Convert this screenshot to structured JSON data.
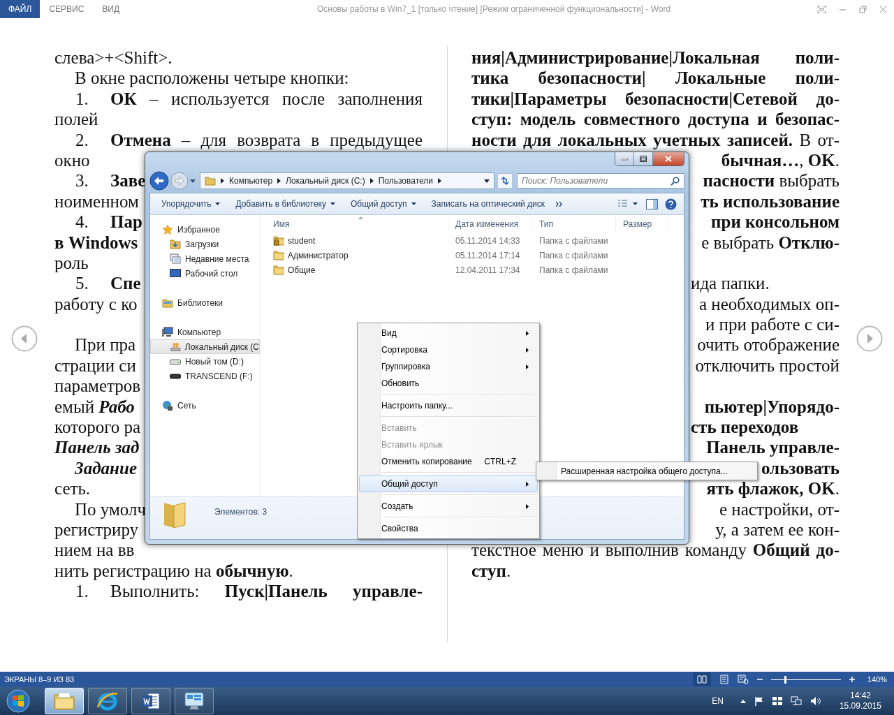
{
  "word": {
    "tabs": [
      {
        "label": "ФАЙЛ",
        "selected": true
      },
      {
        "label": "СЕРВИС",
        "selected": false
      },
      {
        "label": "ВИД",
        "selected": false
      }
    ],
    "title": "Основы работы в  Win7_1 [только чтение] [Режим ограниченной функциональности] - Word"
  },
  "document": {
    "left_column": [
      {
        "kind": "line",
        "justify": false,
        "text": "слева>+<Shift>."
      },
      {
        "kind": "first",
        "justify": false,
        "text": "В окне расположены четыре кнопки:"
      },
      {
        "kind": "item",
        "number": "1.",
        "justify": true,
        "text": "**ОК** – используется после заполнения"
      },
      {
        "kind": "line",
        "justify": false,
        "text": "полей"
      },
      {
        "kind": "item",
        "number": "2.",
        "justify": true,
        "text": "**Отмена** – для возврата в предыдущее"
      },
      {
        "kind": "line",
        "justify": false,
        "text": "окно"
      },
      {
        "kind": "item",
        "number": "3.",
        "justify": false,
        "text": "**Заве**"
      },
      {
        "kind": "line",
        "justify": false,
        "text": "ноименном"
      },
      {
        "kind": "item",
        "number": "4.",
        "justify": false,
        "text": "**Пар**"
      },
      {
        "kind": "line",
        "justify": false,
        "text": "**в Windows**"
      },
      {
        "kind": "line",
        "justify": false,
        "text": "роль"
      },
      {
        "kind": "item",
        "number": "5.",
        "justify": false,
        "text": "**Спе**"
      },
      {
        "kind": "line",
        "justify": false,
        "text": "работу с ко"
      },
      {
        "kind": "blank"
      },
      {
        "kind": "first",
        "justify": false,
        "text": "При пра"
      },
      {
        "kind": "line",
        "justify": false,
        "text": "страции си"
      },
      {
        "kind": "line",
        "justify": false,
        "text": "параметров"
      },
      {
        "kind": "line",
        "justify": false,
        "text": "емый *Рабо*"
      },
      {
        "kind": "line",
        "justify": false,
        "text": "которого ра"
      },
      {
        "kind": "line",
        "justify": false,
        "text": "*Панель зад*"
      },
      {
        "kind": "first",
        "justify": false,
        "text": "*Задание*"
      },
      {
        "kind": "line",
        "justify": false,
        "text": "сеть."
      },
      {
        "kind": "first",
        "justify": false,
        "text": "По умолч"
      },
      {
        "kind": "line",
        "justify": false,
        "text": "регистриру"
      },
      {
        "kind": "line",
        "justify": false,
        "text": "нием на вв"
      },
      {
        "kind": "line",
        "justify": false,
        "text": "нить регистрацию на **обычную**."
      },
      {
        "kind": "item",
        "number": "1.",
        "justify": true,
        "text": "Выполнить: **Пуск|Панель управле-**"
      }
    ],
    "right_column": [
      {
        "kind": "line",
        "justify": true,
        "text": "**ния|Администрирование|Локальная поли-**"
      },
      {
        "kind": "line",
        "justify": true,
        "text": "**тика безопасности| Локальные поли-**"
      },
      {
        "kind": "line",
        "justify": true,
        "text": "**тики|Параметры безопасности|Сетевой до-**"
      },
      {
        "kind": "line",
        "justify": true,
        "text": "**ступ: модель совместного доступа и безопас-**"
      },
      {
        "kind": "line",
        "justify": true,
        "text": "**ности для локальных учетных записей.** В от-"
      },
      {
        "kind": "tail",
        "justify": true,
        "text": "**бычная…**, **OK**."
      },
      {
        "kind": "tail",
        "justify": true,
        "text": "**пасности** выбрать"
      },
      {
        "kind": "tail",
        "justify": true,
        "text": "**ть использование**"
      },
      {
        "kind": "tail",
        "justify": true,
        "text": "**при консольном**"
      },
      {
        "kind": "tail",
        "justify": true,
        "text": "е выбрать **Отклю-**"
      },
      {
        "kind": "blank"
      },
      {
        "kind": "tail",
        "justify": false,
        "text": "ида папки."
      },
      {
        "kind": "tail",
        "justify": true,
        "text": "а необходимых оп-"
      },
      {
        "kind": "tail",
        "justify": true,
        "text": "и при работе с си-"
      },
      {
        "kind": "tail",
        "justify": true,
        "text": "очить отображение"
      },
      {
        "kind": "tail",
        "justify": true,
        "text": "отключить простой"
      },
      {
        "kind": "blank"
      },
      {
        "kind": "tail",
        "justify": true,
        "text": "**пьютер|Упорядо-**"
      },
      {
        "kind": "tail",
        "justify": false,
        "text": "**сть переходов**"
      },
      {
        "kind": "tail",
        "justify": true,
        "text": "**Панель управле-**"
      },
      {
        "kind": "tail",
        "justify": true,
        "text": "**ользовать**"
      },
      {
        "kind": "tail",
        "justify": true,
        "text": "**ять флажок, OK**."
      },
      {
        "kind": "tail",
        "justify": true,
        "text": "е настройки, от-"
      },
      {
        "kind": "tail",
        "justify": true,
        "text": "у, а затем ее кон-"
      },
      {
        "kind": "line",
        "justify": true,
        "text": "текстное меню и выполнив команду **Общий до-**"
      },
      {
        "kind": "line",
        "justify": false,
        "text": "**ступ**."
      }
    ]
  },
  "explorer": {
    "breadcrumbs": [
      "Компьютер",
      "Локальный диск (C:)",
      "Пользователи"
    ],
    "search": {
      "placeholder": "Поиск: Пользователи"
    },
    "toolbar": [
      {
        "label": "Упорядочить",
        "dropdown": true
      },
      {
        "label": "Добавить в библиотеку",
        "dropdown": true
      },
      {
        "label": "Общий доступ",
        "dropdown": true
      },
      {
        "label": "Записать на оптический диск",
        "dropdown": false
      }
    ],
    "nav_groups": [
      {
        "label": "Избранное",
        "selected": false,
        "children": [
          {
            "label": "Загрузки",
            "selected": false
          },
          {
            "label": "Недавние места",
            "selected": false
          },
          {
            "label": "Рабочий стол",
            "selected": false
          }
        ]
      },
      {
        "label": "Библиотеки",
        "selected": false
      },
      {
        "label": "Компьютер",
        "selected": false,
        "children": [
          {
            "label": "Локальный диск (C",
            "selected": true
          },
          {
            "label": "Новый том (D:)",
            "selected": false
          },
          {
            "label": "TRANSCEND (F:)",
            "selected": false
          }
        ]
      },
      {
        "label": "Сеть",
        "selected": false
      }
    ],
    "columns": [
      "Имя",
      "Дата изменения",
      "Тип",
      "Размер"
    ],
    "rows": [
      {
        "name": "student",
        "date": "05.11.2014 14:33",
        "type": "Папка с файлами",
        "locked": true
      },
      {
        "name": "Администратор",
        "date": "05.11.2014 17:14",
        "type": "Папка с файлами",
        "locked": false
      },
      {
        "name": "Общие",
        "date": "12.04.2011 17:34",
        "type": "Папка с файлами",
        "locked": false
      }
    ],
    "status": "Элементов: 3"
  },
  "context_menu": {
    "items": [
      {
        "kind": "item",
        "label": "Вид",
        "submenu": true,
        "disabled": false,
        "selected": false
      },
      {
        "kind": "item",
        "label": "Сортировка",
        "submenu": true,
        "disabled": false,
        "selected": false
      },
      {
        "kind": "item",
        "label": "Группировка",
        "submenu": true,
        "disabled": false,
        "selected": false
      },
      {
        "kind": "item",
        "label": "Обновить",
        "submenu": false,
        "disabled": false,
        "selected": false
      },
      {
        "kind": "separator"
      },
      {
        "kind": "item",
        "label": "Настроить папку...",
        "submenu": false,
        "disabled": false,
        "selected": false
      },
      {
        "kind": "separator"
      },
      {
        "kind": "item",
        "label": "Вставить",
        "submenu": false,
        "disabled": true,
        "selected": false
      },
      {
        "kind": "item",
        "label": "Вставить ярлык",
        "submenu": false,
        "disabled": true,
        "selected": false
      },
      {
        "kind": "item",
        "label": "Отменить копирование",
        "shortcut": "CTRL+Z",
        "submenu": false,
        "disabled": false,
        "selected": false
      },
      {
        "kind": "separator"
      },
      {
        "kind": "item",
        "label": "Общий доступ",
        "submenu": true,
        "disabled": false,
        "selected": true
      },
      {
        "kind": "separator"
      },
      {
        "kind": "item",
        "label": "Создать",
        "submenu": true,
        "disabled": false,
        "selected": false
      },
      {
        "kind": "separator"
      },
      {
        "kind": "item",
        "label": "Свойства",
        "submenu": false,
        "disabled": false,
        "selected": false
      }
    ]
  },
  "submenu": {
    "items": [
      {
        "label": "Расширенная настройка общего доступа..."
      }
    ]
  },
  "status_bar": {
    "pages": "ЭКРАНЫ 8–9 ИЗ 83",
    "zoom": {
      "level": 0.2,
      "reading": "140%"
    }
  },
  "taskbar": {
    "apps": [
      {
        "active": true
      },
      {
        "active": false
      },
      {
        "active": false
      },
      {
        "active": false
      }
    ],
    "language": "EN",
    "time": "14:42",
    "date": "15.09.2015"
  }
}
